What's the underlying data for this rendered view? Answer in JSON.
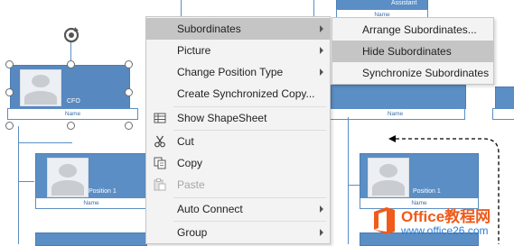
{
  "chart": {
    "cfo": {
      "title": "CFO",
      "name": "Name"
    },
    "assistant": {
      "title": "Assistant",
      "name": "Name"
    },
    "cto": {
      "name": "Name"
    },
    "left_position": {
      "title": "Position 1",
      "name": "Name"
    },
    "right_position": {
      "title": "Position 1",
      "name": "Name"
    }
  },
  "context_menu": {
    "items": [
      {
        "label": "Subordinates",
        "has_submenu": true,
        "highlighted": true
      },
      {
        "label": "Picture",
        "has_submenu": true
      },
      {
        "label": "Change Position Type",
        "has_submenu": true
      },
      {
        "label": "Create Synchronized Copy...",
        "has_submenu": false
      },
      {
        "label": "Show ShapeSheet",
        "icon": "shapesheet-icon"
      },
      {
        "label": "Cut",
        "icon": "scissors-icon"
      },
      {
        "label": "Copy",
        "icon": "copy-icon"
      },
      {
        "label": "Paste",
        "icon": "paste-icon",
        "disabled": true
      },
      {
        "label": "Auto Connect",
        "has_submenu": true
      },
      {
        "label": "Group",
        "has_submenu": true
      }
    ]
  },
  "submenu": {
    "items": [
      {
        "label": "Arrange Subordinates..."
      },
      {
        "label": "Hide Subordinates",
        "highlighted": true
      },
      {
        "label": "Synchronize Subordinates"
      }
    ]
  },
  "watermark": {
    "brand": "Office教程网",
    "url": "www.office26.com",
    "colors": {
      "orange": "#f05a1a",
      "blue": "#2a7fd4"
    }
  }
}
